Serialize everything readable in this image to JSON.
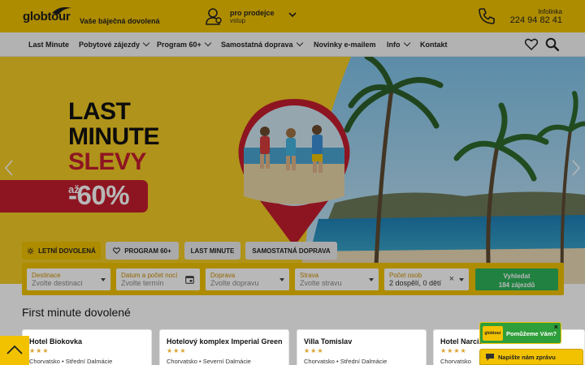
{
  "header": {
    "logo_text": "globtour",
    "tagline": "Vaše báječná dovolená",
    "seller_title": "pro prodejce",
    "seller_sub": "vstup",
    "infoline_label": "Infolinka",
    "phone": "224 94 82 41"
  },
  "nav": {
    "items": [
      {
        "label": "Last Minute"
      },
      {
        "label": "Pobytové zájezdy"
      },
      {
        "label": "Program 60+"
      },
      {
        "label": "Samostatná doprava"
      },
      {
        "label": "Novinky e-mailem"
      },
      {
        "label": "Info"
      },
      {
        "label": "Kontakt"
      }
    ]
  },
  "hero": {
    "line1": "LAST",
    "line2": "MINUTE",
    "line3": "SLEVY",
    "discount_prefix": "až",
    "discount": "-60%"
  },
  "tabs": [
    {
      "label": "LETNÍ DOVOLENÁ",
      "icon": "sun-icon",
      "active": true
    },
    {
      "label": "PROGRAM 60+",
      "icon": "heart-icon",
      "active": false
    },
    {
      "label": "LAST MINUTE",
      "active": false
    },
    {
      "label": "SAMOSTATNÁ DOPRAVA",
      "active": false
    }
  ],
  "search": {
    "fields": [
      {
        "label": "Destinace",
        "value": "Zvolte destinaci"
      },
      {
        "label": "Datum a počet nocí",
        "value": "Zvolte termín"
      },
      {
        "label": "Doprava",
        "value": "Zvolte dopravu"
      },
      {
        "label": "Strava",
        "value": "Zvolte stravu"
      },
      {
        "label": "Počet osob",
        "value": "2 dospělí, 0 dětí"
      }
    ],
    "button_line1": "Vyhledat",
    "button_line2": "184 zájezdů"
  },
  "section": {
    "title": "First minute dovolené",
    "cards": [
      {
        "name": "Hotel Biokovka",
        "stars": "★★★",
        "location": "Chorvatsko • Střední Dalmácie"
      },
      {
        "name": "Hotelový komplex Imperial Green",
        "stars": "★★★",
        "location": "Chorvatsko • Severní Dalmácie"
      },
      {
        "name": "Villa Tomislav",
        "stars": "★★★",
        "location": "Chorvatsko • Střední Dalmácie"
      },
      {
        "name": "Hotel Narcis",
        "stars": "★★★★",
        "location": "Chorvatsko"
      }
    ]
  },
  "chat": {
    "logo": "globtour",
    "bubble_text": "Pomůžeme Vám?",
    "close": "×",
    "bar_text": "Napište nám zprávu"
  },
  "colors": {
    "brand_yellow": "#f2c200",
    "brand_red": "#c41e2e",
    "search_green": "#2eb35b"
  }
}
